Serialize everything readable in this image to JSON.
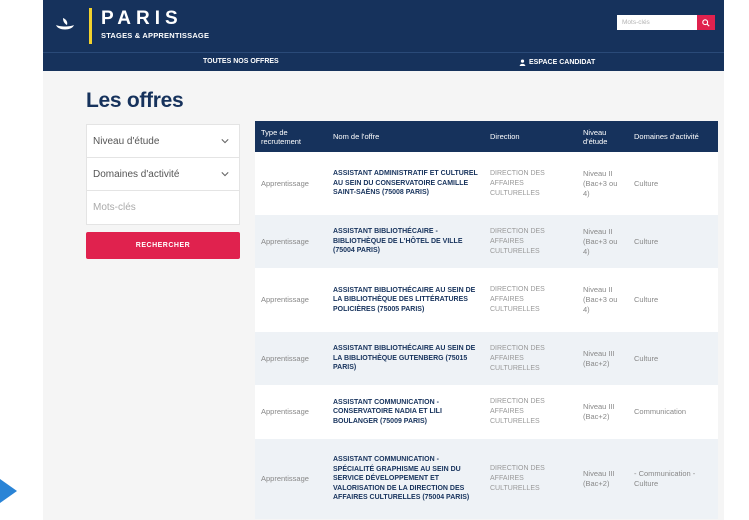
{
  "header": {
    "brand_title": "PARIS",
    "brand_subtitle": "STAGES & APPRENTISSAGE",
    "search_placeholder": "Mots-clés"
  },
  "nav": {
    "offres": "TOUTES NOS OFFRES",
    "espace": "ESPACE CANDIDAT"
  },
  "page_title": "Les offres",
  "filters": {
    "niveau": "Niveau d'étude",
    "domaines": "Domaines d'activité",
    "keywords_placeholder": "Mots-clés",
    "search_button": "RECHERCHER"
  },
  "table": {
    "headers": [
      "Type de recrutement",
      "Nom de l'offre",
      "Direction",
      "Niveau d'étude",
      "Domaines d'activité"
    ],
    "rows": [
      {
        "type": "Apprentissage",
        "name": "ASSISTANT ADMINISTRATIF ET CULTUREL AU SEIN DU CONSERVATOIRE CAMILLE SAINT-SAËNS (75008 PARIS)",
        "direction": "DIRECTION DES AFFAIRES CULTURELLES",
        "niveau": "Niveau II (Bac+3 ou 4)",
        "domaine": "Culture"
      },
      {
        "type": "Apprentissage",
        "name": "ASSISTANT BIBLIOTHÉCAIRE - BIBLIOTHÈQUE DE L'HÔTEL DE VILLE (75004 PARIS)",
        "direction": "DIRECTION DES AFFAIRES CULTURELLES",
        "niveau": "Niveau II (Bac+3 ou 4)",
        "domaine": "Culture"
      },
      {
        "type": "Apprentissage",
        "name": "ASSISTANT BIBLIOTHÉCAIRE AU SEIN DE LA BIBLIOTHÈQUE DES LITTÉRATURES POLICIÈRES (75005 PARIS)",
        "direction": "DIRECTION DES AFFAIRES CULTURELLES",
        "niveau": "Niveau II (Bac+3 ou 4)",
        "domaine": "Culture"
      },
      {
        "type": "Apprentissage",
        "name": "ASSISTANT BIBLIOTHÉCAIRE AU SEIN DE LA BIBLIOTHÈQUE GUTENBERG (75015 PARIS)",
        "direction": "DIRECTION DES AFFAIRES CULTURELLES",
        "niveau": "Niveau III (Bac+2)",
        "domaine": "Culture"
      },
      {
        "type": "Apprentissage",
        "name": "ASSISTANT COMMUNICATION - CONSERVATOIRE NADIA ET LILI BOULANGER (75009 PARIS)",
        "direction": "DIRECTION DES AFFAIRES CULTURELLES",
        "niveau": "Niveau III (Bac+2)",
        "domaine": "Communication"
      },
      {
        "type": "Apprentissage",
        "name": "ASSISTANT COMMUNICATION - SPÉCIALITÉ GRAPHISME AU SEIN DU SERVICE DÉVELOPPEMENT ET VALORISATION DE LA DIRECTION DES AFFAIRES CULTURELLES (75004 PARIS)",
        "direction": "DIRECTION DES AFFAIRES CULTURELLES",
        "niveau": "Niveau III (Bac+2)",
        "domaine": "- Communication - Culture"
      }
    ]
  },
  "colors": {
    "navy": "#16325c",
    "accent": "#e0224e",
    "gold": "#f2d22e",
    "pointer": "#2a84d6"
  }
}
